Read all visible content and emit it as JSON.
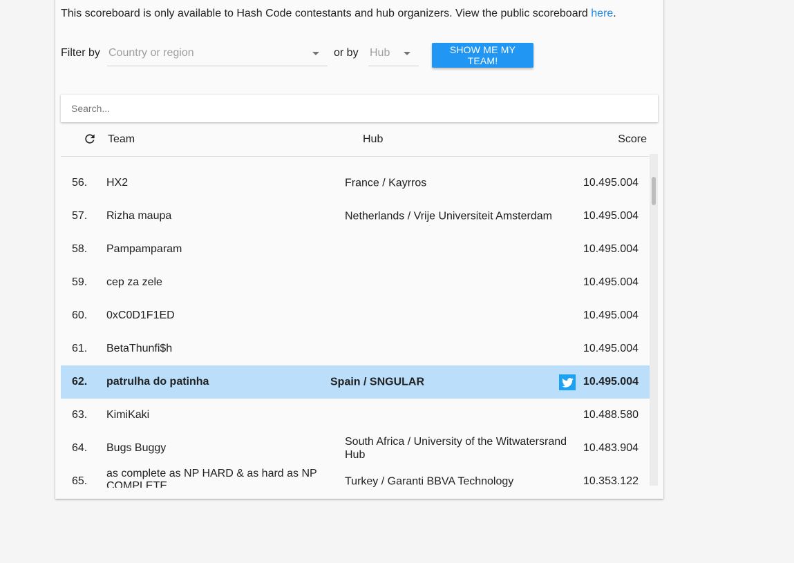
{
  "notice": {
    "text": "This scoreboard is only available to Hash Code contestants and hub organizers. View the public scoreboard ",
    "link": "here",
    "trailing": "."
  },
  "filters": {
    "filter_by_label": "Filter by",
    "country_placeholder": "Country or region",
    "or_by_label": "or by",
    "hub_placeholder": "Hub",
    "show_team_button": "SHOW ME MY TEAM!"
  },
  "search": {
    "placeholder": "Search..."
  },
  "table": {
    "headers": {
      "team": "Team",
      "hub": "Hub",
      "score": "Score"
    },
    "rows": [
      {
        "rank": "56.",
        "team": "HX2",
        "hub": "France / Kayrros",
        "score": "10.495.004"
      },
      {
        "rank": "57.",
        "team": "Rizha maupa",
        "hub": "Netherlands / Vrije Universiteit Amsterdam",
        "score": "10.495.004"
      },
      {
        "rank": "58.",
        "team": "Pampamparam",
        "hub": "",
        "score": "10.495.004"
      },
      {
        "rank": "59.",
        "team": "cep za zele",
        "hub": "",
        "score": "10.495.004"
      },
      {
        "rank": "60.",
        "team": "0xC0D1F1ED",
        "hub": "",
        "score": "10.495.004"
      },
      {
        "rank": "61.",
        "team": "BetaThunfi$h",
        "hub": "",
        "score": "10.495.004"
      },
      {
        "rank": "62.",
        "team": "patrulha do patinha",
        "hub": "Spain / SNGULAR",
        "score": "10.495.004",
        "highlighted": true
      },
      {
        "rank": "63.",
        "team": "KimiKaki",
        "hub": "",
        "score": "10.488.580"
      },
      {
        "rank": "64.",
        "team": "Bugs Buggy",
        "hub": "South Africa / University of the Witwatersrand Hub",
        "score": "10.483.904"
      },
      {
        "rank": "65.",
        "team": "as complete as NP HARD & as hard as NP COMPLETE",
        "hub": "Turkey / Garanti BBVA Technology",
        "score": "10.353.122"
      }
    ]
  },
  "icons": {
    "refresh": "refresh-icon",
    "twitter": "twitter-icon",
    "dropdown": "chevron-down-icon"
  },
  "colors": {
    "accent": "#2196f3",
    "link": "#1e88e5",
    "highlight_row": "#bbdefb",
    "twitter": "#1da1f2"
  }
}
